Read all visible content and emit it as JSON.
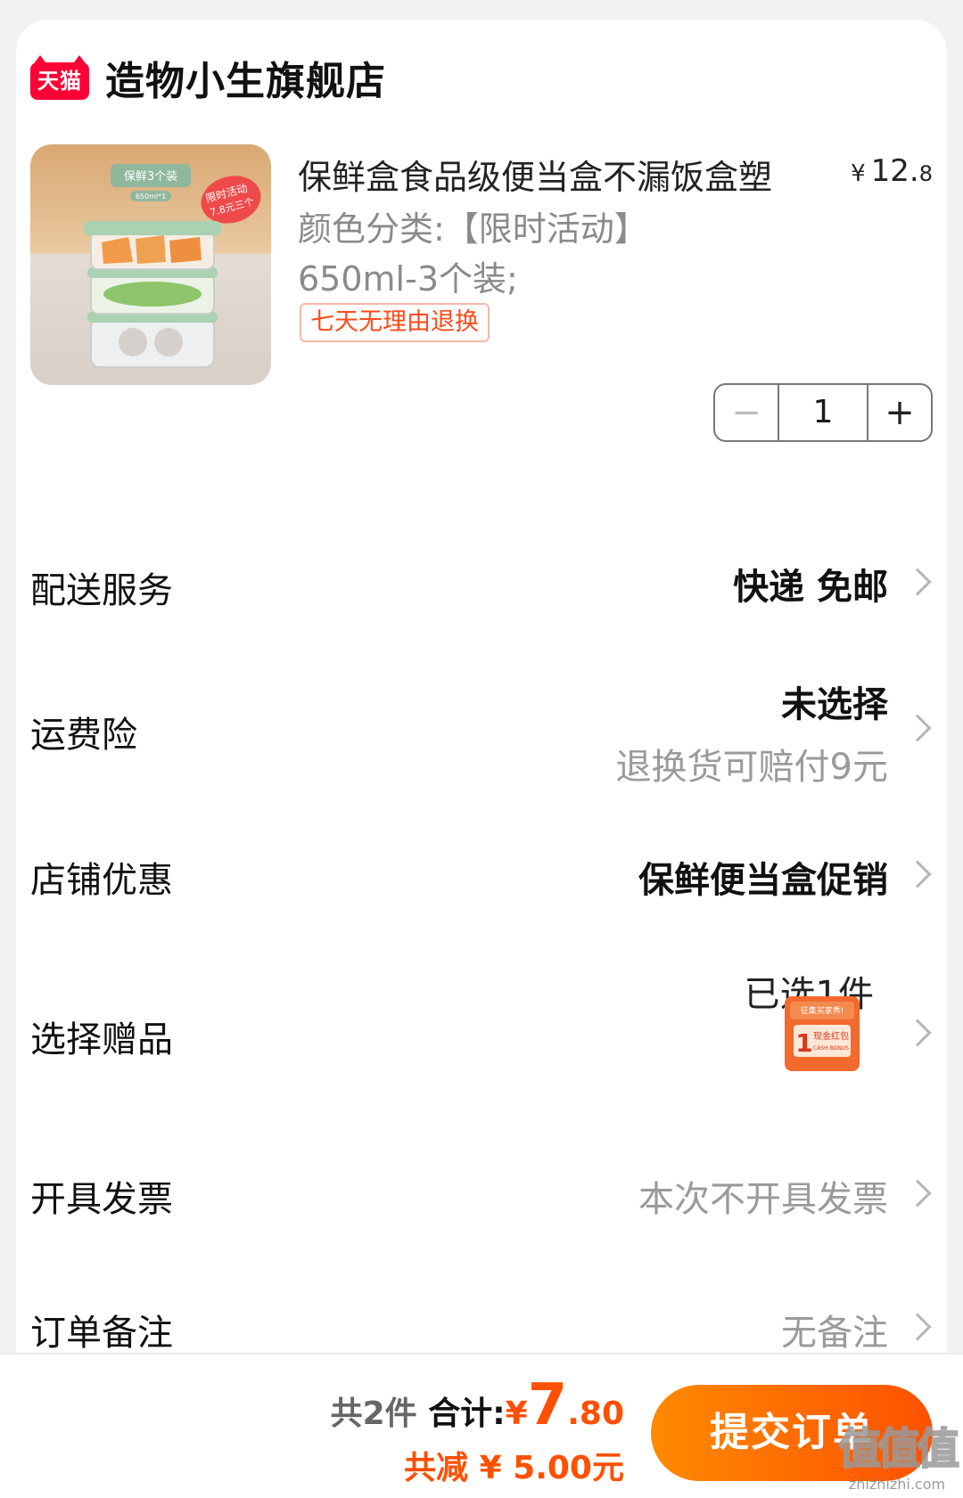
{
  "shop": {
    "logo_text": "天猫",
    "name": "造物小生旗舰店"
  },
  "product": {
    "title": "保鲜盒食品级便当盒不漏饭盒塑",
    "price_currency": "¥",
    "price_int": "12.",
    "price_dec": "8",
    "sku_line1": "颜色分类:【限时活动】",
    "sku_line2": "650ml-3个装;",
    "return_tag": "七天无理由退换",
    "quantity": "1",
    "minus_label": "−",
    "plus_label": "+",
    "image_text": {
      "badge": "保鲜3个装",
      "size": "650ml*1",
      "promo_line1": "限时活动",
      "promo_line2": "7.8元三个"
    }
  },
  "rows": {
    "delivery": {
      "label": "配送服务",
      "value": "快递 免邮"
    },
    "shipping_insurance": {
      "label": "运费险",
      "value": "未选择",
      "sub": "退换货可赔付9元"
    },
    "shop_discount": {
      "label": "店铺优惠",
      "value": "保鲜便当盒促销"
    },
    "gift": {
      "label": "选择赠品",
      "value": "已选1件",
      "gift_title": "征集买家秀!",
      "gift_num": "1",
      "gift_name": "现金红包",
      "gift_sub": "CASH BONUS"
    },
    "invoice": {
      "label": "开具发票",
      "value": "本次不开具发票"
    },
    "note": {
      "label": "订单备注",
      "value": "无备注"
    }
  },
  "footer": {
    "count": "共2件",
    "total_label": "合计:",
    "currency": "¥",
    "total_int": "7",
    "total_dec": ".80",
    "discount": "共减 ¥ 5.00元",
    "submit": "提交订单",
    "watermark_big": "值值值",
    "watermark_small": "zhizhizhi.com"
  },
  "colors": {
    "accent": "#ff5000",
    "tmall_red": "#ff0036"
  }
}
